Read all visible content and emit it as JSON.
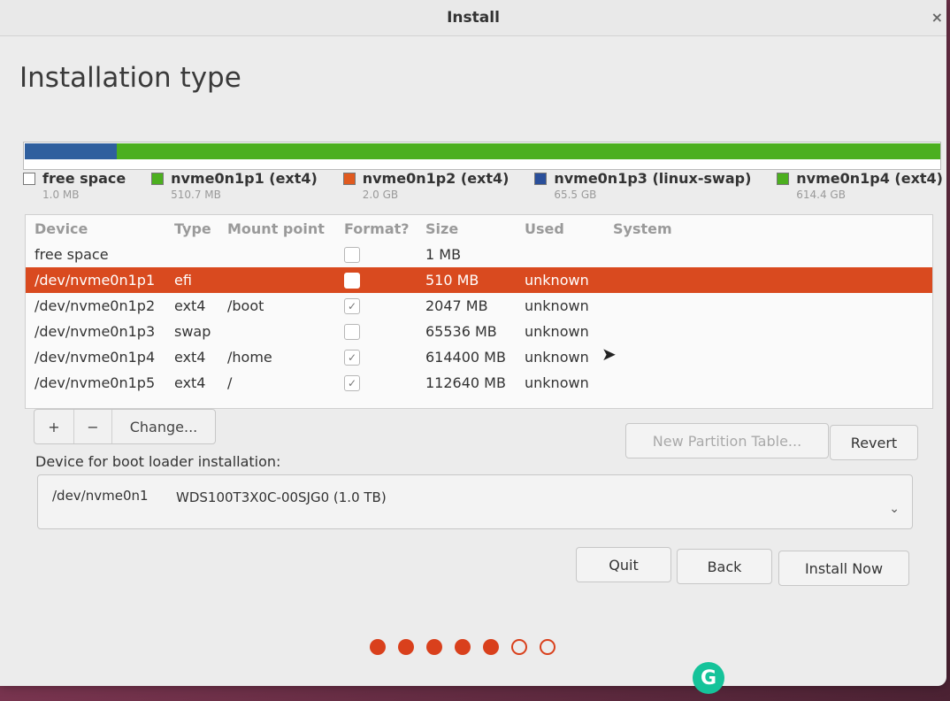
{
  "window": {
    "title": "Install"
  },
  "page": {
    "heading": "Installation type"
  },
  "partition_bar": [
    {
      "name": "free space",
      "color": "#ffffff",
      "fraction": 0.001
    },
    {
      "name": "nvme0n1p1 (ext4)",
      "color": "#2f5f9e",
      "fraction": 0.1
    },
    {
      "name": "nvme0n1p4 (ext4)",
      "color": "#4caf1f",
      "fraction": 0.899
    }
  ],
  "legend": [
    {
      "label": "free space",
      "sub": "1.0 MB",
      "color": "#ffffff"
    },
    {
      "label": "nvme0n1p1 (ext4)",
      "sub": "510.7 MB",
      "color": "#4caf1f"
    },
    {
      "label": "nvme0n1p2 (ext4)",
      "sub": "2.0 GB",
      "color": "#e05a1f"
    },
    {
      "label": "nvme0n1p3 (linux-swap)",
      "sub": "65.5 GB",
      "color": "#2a4f9a"
    },
    {
      "label": "nvme0n1p4 (ext4)",
      "sub": "614.4 GB",
      "color": "#4caf1f"
    }
  ],
  "table": {
    "headers": [
      "Device",
      "Type",
      "Mount point",
      "Format?",
      "Size",
      "Used",
      "System"
    ],
    "rows": [
      {
        "device": "free space",
        "type": "",
        "mount": "",
        "format": false,
        "size": "1 MB",
        "used": "",
        "system": ""
      },
      {
        "device": "/dev/nvme0n1p1",
        "type": "efi",
        "mount": "",
        "format": false,
        "size": "510 MB",
        "used": "unknown",
        "system": ""
      },
      {
        "device": "/dev/nvme0n1p2",
        "type": "ext4",
        "mount": "/boot",
        "format": true,
        "size": "2047 MB",
        "used": "unknown",
        "system": ""
      },
      {
        "device": "/dev/nvme0n1p3",
        "type": "swap",
        "mount": "",
        "format": false,
        "size": "65536 MB",
        "used": "unknown",
        "system": ""
      },
      {
        "device": "/dev/nvme0n1p4",
        "type": "ext4",
        "mount": "/home",
        "format": true,
        "size": "614400 MB",
        "used": "unknown",
        "system": ""
      },
      {
        "device": "/dev/nvme0n1p5",
        "type": "ext4",
        "mount": "/",
        "format": true,
        "size": "112640 MB",
        "used": "unknown",
        "system": ""
      }
    ]
  },
  "toolbar": {
    "add": "+",
    "remove": "−",
    "change": "Change..."
  },
  "buttons": {
    "new_partition_table": "New Partition Table...",
    "revert": "Revert",
    "quit": "Quit",
    "back": "Back",
    "install_now": "Install Now"
  },
  "boot": {
    "label": "Device for boot loader installation:",
    "device": "/dev/nvme0n1",
    "model": "WDS100T3X0C-00SJG0 (1.0 TB)"
  },
  "progress": {
    "total_steps": 7,
    "completed_steps": 5
  },
  "grammarly": {
    "letter": "G"
  }
}
